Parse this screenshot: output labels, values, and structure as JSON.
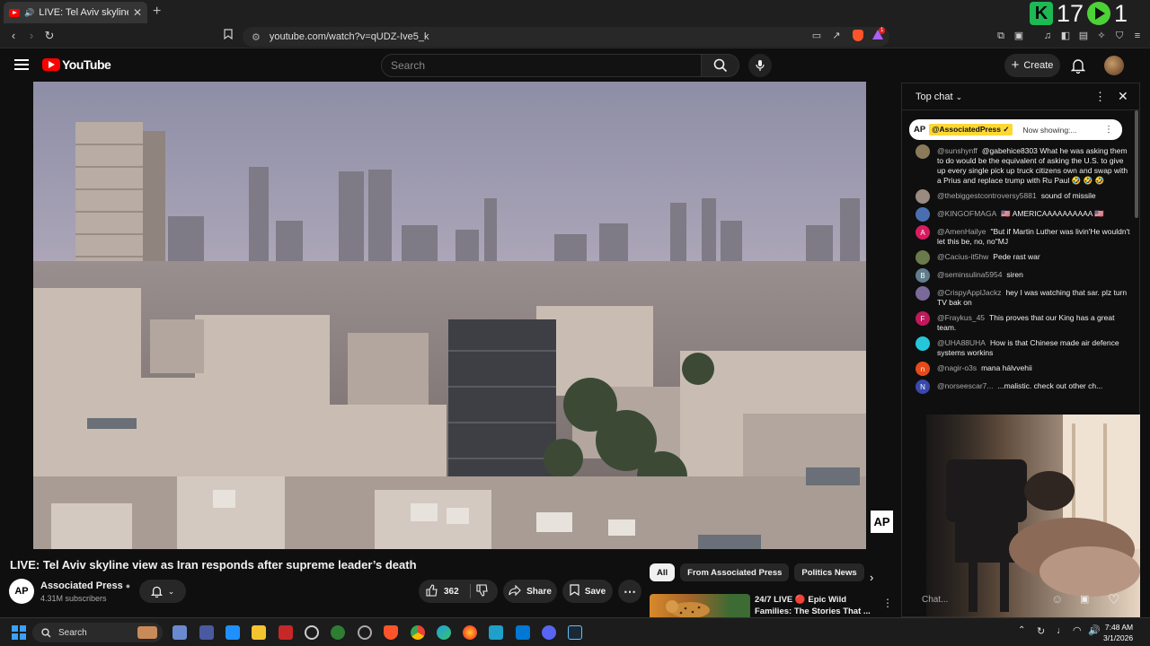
{
  "browser": {
    "tab_title": "LIVE: Tel Aviv skyline view as I",
    "tab_close": "✕",
    "new_tab": "+",
    "url": "youtube.com/watch?v=qUDZ-Ive5_k",
    "extension_badge": "1",
    "overlay_counter": "17",
    "overlay_counter_right": "1"
  },
  "youtube": {
    "logo_text": "YouTube",
    "search_placeholder": "Search",
    "create_label": "Create"
  },
  "video": {
    "title": "LIVE: Tel Aviv skyline view as Iran responds after supreme leader’s death",
    "watermark": "AP",
    "channel_logo": "AP",
    "channel_name": "Associated Press",
    "subscribers": "4.31M subscribers",
    "likes": "362",
    "share_label": "Share",
    "save_label": "Save"
  },
  "recommendations": {
    "chips": [
      "All",
      "From Associated Press",
      "Politics News"
    ],
    "active_chip": "All",
    "item_title_line1": "24/7 LIVE 🔴 Epic Wild",
    "item_title_line2": "Families: The Stories That ..."
  },
  "chat": {
    "header": "Top chat",
    "pinned_logo": "AP",
    "pinned_author": "@AssociatedPress ✓",
    "pinned_text": "Now showing:...",
    "input_placeholder": "Chat...",
    "messages": [
      {
        "author": "@sunshynff",
        "text": "@gabehice8303 What he was asking them to do would be the equivalent of asking the U.S. to give up every single pick up truck citizens own and swap with a Prius and replace trump with Ru Paul 🤣 🤣 🤣",
        "avatar_color": "#8a7a5a",
        "initial": ""
      },
      {
        "author": "@thebiggestcontroversy5881",
        "text": "sound of missile",
        "avatar_color": "#9a8a80",
        "initial": ""
      },
      {
        "author": "@KINGOFMAGA",
        "text": "🇺🇸 AMERICAAAAAAAAAA 🇺🇸",
        "avatar_color": "#4a6fb0",
        "initial": ""
      },
      {
        "author": "@AmenHailye",
        "text": "\"But if Martin Luther was livin'He wouldn't let this be, no, no\"MJ",
        "avatar_color": "#d81b60",
        "initial": "A"
      },
      {
        "author": "@Cacius-it5hw",
        "text": "Pede rast war",
        "avatar_color": "#6a7a4a",
        "initial": ""
      },
      {
        "author": "@seminsulina5954",
        "text": "siren",
        "avatar_color": "#607d8b",
        "initial": "B"
      },
      {
        "author": "@CrispyApplJackz",
        "text": "hey I was watching that sar. plz turn TV bak on",
        "avatar_color": "#7a6a9a",
        "initial": ""
      },
      {
        "author": "@Fraykus_45",
        "text": "This proves that our King has a great team.",
        "avatar_color": "#c2185b",
        "initial": "F"
      },
      {
        "author": "@UHA88UHA",
        "text": "How is that Chinese made air defence systems workins",
        "avatar_color": "#26c6da",
        "initial": ""
      },
      {
        "author": "@nagir-o3s",
        "text": "mana hálvvehii",
        "avatar_color": "#e64a19",
        "initial": "n"
      },
      {
        "author": "@norseescar7...",
        "text": "...malistic. check out other ch...",
        "avatar_color": "#3949ab",
        "initial": "N"
      }
    ]
  },
  "taskbar": {
    "search_label": "Search",
    "time": "7:48 AM",
    "date": "3/1/2026"
  }
}
